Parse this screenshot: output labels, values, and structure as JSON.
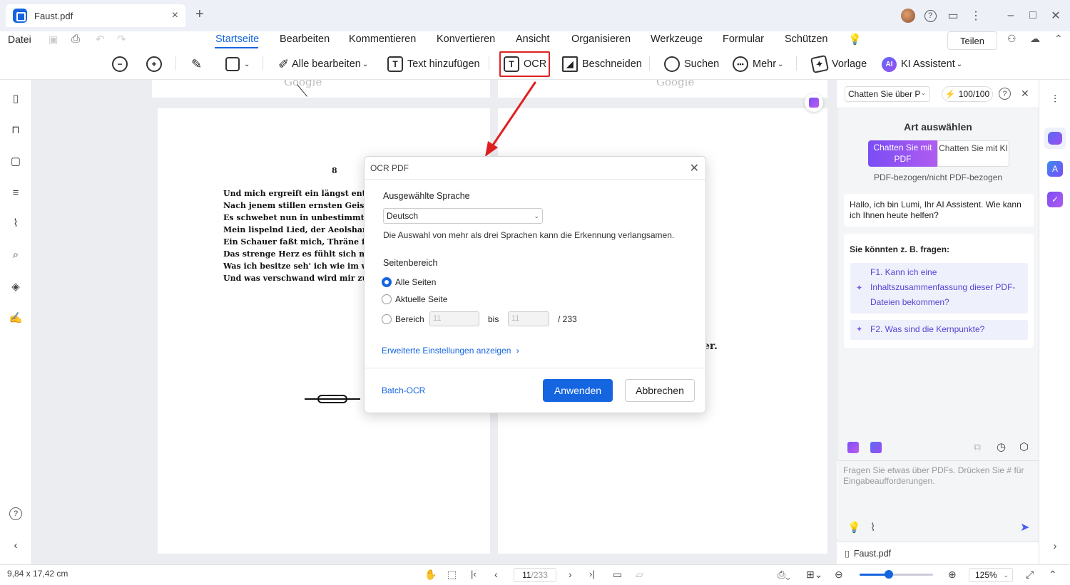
{
  "window": {
    "tab_name": "Faust.pdf",
    "tab_close": "×",
    "new_tab": "+"
  },
  "menu": {
    "file_label": "Datei",
    "items": [
      "Startseite",
      "Bearbeiten",
      "Kommentieren",
      "Konvertieren",
      "Ansicht",
      "Organisieren",
      "Werkzeuge",
      "Formular",
      "Schützen"
    ],
    "active": "Startseite",
    "share_label": "Teilen"
  },
  "toolbar": {
    "edit_all": "Alle bearbeiten",
    "add_text": "Text hinzufügen",
    "ocr": "OCR",
    "crop": "Beschneiden",
    "search": "Suchen",
    "more": "Mehr",
    "template": "Vorlage",
    "ai_assistant": "KI Assistent",
    "ai_badge": "AI"
  },
  "document": {
    "page_number": "8",
    "watermark": "Google",
    "lines": [
      "Und mich ergreift ein längst entwöhnt",
      "Nach jenem stillen ernsten Geisterreich",
      "Es schwebet nun in unbestimmten Tön",
      "Mein lispelnd Lied, der Aeolsharfe gl",
      "Ein Schauer faßt mich, Thräne folgt",
      "Das strenge Herz es fühlt sich mild u",
      "Was ich besitze seh' ich wie im weite",
      "Und was verschwand wird mir zu W"
    ],
    "right_fragment": "er."
  },
  "dialog": {
    "title": "OCR PDF",
    "language_label": "Ausgewählte Sprache",
    "language_value": "Deutsch",
    "language_hint": "Die Auswahl von mehr als drei Sprachen kann die Erkennung verlangsamen.",
    "range_label": "Seitenbereich",
    "opt_all": "Alle Seiten",
    "opt_current": "Aktuelle Seite",
    "opt_range": "Bereich",
    "range_from": "11",
    "range_to": "11",
    "range_bis": "bis",
    "range_total": "/ 233",
    "selected_option": "Alle Seiten",
    "advanced_link": "Erweiterte Einstellungen anzeigen",
    "batch_link": "Batch-OCR",
    "apply": "Anwenden",
    "cancel": "Abbrechen"
  },
  "ai_panel": {
    "chat_select": "Chatten Sie über P",
    "credits": "100/100",
    "heading": "Art auswählen",
    "seg_pdf": "Chatten Sie mit PDF",
    "seg_ki": "Chatten Sie mit KI",
    "seg_note": "PDF-bezogen/nicht PDF-bezogen",
    "greeting": "Hallo, ich bin Lumi, Ihr AI Assistent. Wie kann ich Ihnen heute helfen?",
    "suggest_label": "Sie könnten z. B. fragen:",
    "suggestions": [
      "F1. Kann ich eine Inhaltszusammenfassung dieser PDF-Dateien bekommen?",
      "F2. Was sind die Kernpunkte?"
    ],
    "input_placeholder": "Fragen Sie etwas über PDFs. Drücken Sie # für Eingabeaufforderungen.",
    "file_chip": "Faust.pdf"
  },
  "statusbar": {
    "dimensions": "9,84 x 17,42 cm",
    "page_current": "11",
    "page_total": "/233",
    "zoom": "125%",
    "zoom_fraction": 0.4
  },
  "colors": {
    "accent": "#1565e0",
    "highlight_red": "#dd2222",
    "ai_purple": "#7a4df5"
  }
}
